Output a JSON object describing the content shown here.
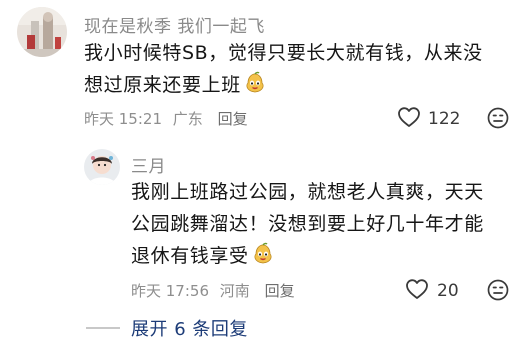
{
  "comments": [
    {
      "username": "现在是秋季 我们一起飞",
      "text_line1": "我小时候特SB，觉得只要长大就有钱，从来没",
      "text_line2": "想过原来还要上班",
      "time": "昨天 15:21",
      "location": "广东",
      "reply_label": "回复",
      "likes": "122"
    },
    {
      "username": "三月",
      "text_line1": "我刚上班路过公园，就想老人真爽，天天",
      "text_line2": "公园跳舞溜达！没想到要上好几十年才能",
      "text_line3": "退休有钱享受",
      "time": "昨天 17:56",
      "location": "河南",
      "reply_label": "回复",
      "likes": "20"
    }
  ],
  "expand_replies": "展开 6 条回复",
  "colors": {
    "username": "#8a8a8a",
    "meta": "#8e8e8e",
    "link": "#1d3c78"
  },
  "icons": [
    "heart-outline-icon",
    "dislike-face-icon",
    "pear-face-emoji"
  ]
}
